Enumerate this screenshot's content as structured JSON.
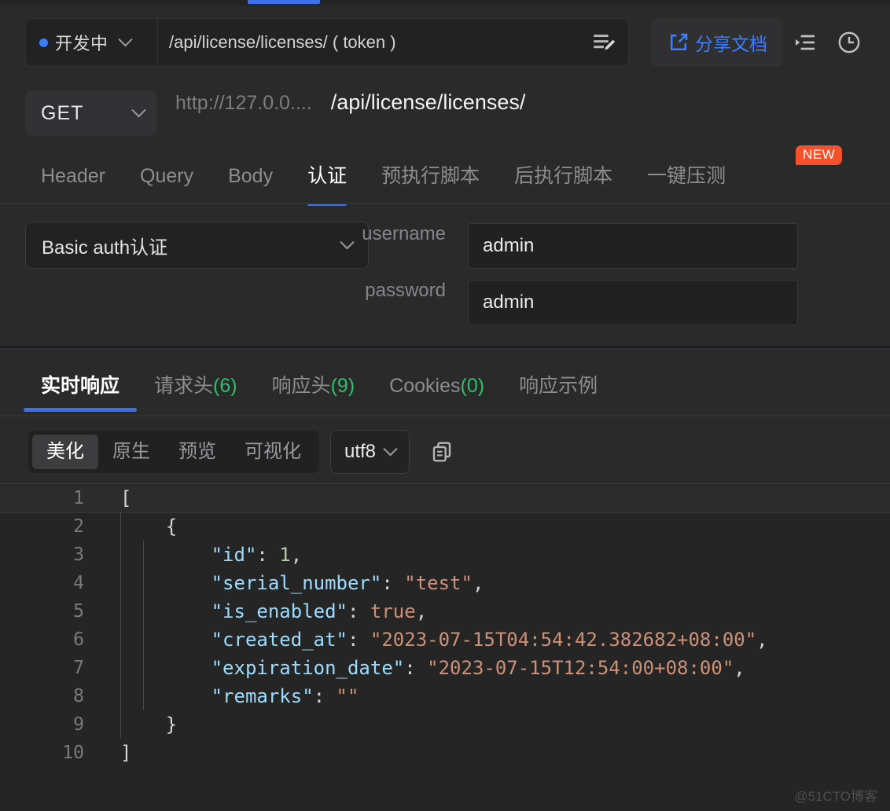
{
  "window": {
    "theme": "dark",
    "accent": "#3d6fe8",
    "badge_color": "#f6502d",
    "count_color": "#2fbf6c"
  },
  "request_header": {
    "status_label": "开发中",
    "api_name": "/api/license/licenses/ ( token )",
    "share_label": "分享文档",
    "icons": {
      "edit": "edit-icon",
      "list": "list-indent-icon",
      "history": "clock-icon",
      "status_chevron": "chevron-down-icon"
    }
  },
  "url_row": {
    "method": "GET",
    "host": "http://127.0.0....",
    "path": "/api/license/licenses/"
  },
  "request_tabs": {
    "items": [
      {
        "label": "Header",
        "active": false
      },
      {
        "label": "Query",
        "active": false
      },
      {
        "label": "Body",
        "active": false
      },
      {
        "label": "认证",
        "active": true
      },
      {
        "label": "预执行脚本",
        "active": false
      },
      {
        "label": "后执行脚本",
        "active": false
      },
      {
        "label": "一键压测",
        "active": false
      }
    ],
    "new_badge": "NEW"
  },
  "auth": {
    "type_value": "Basic auth认证",
    "fields": [
      {
        "label": "username",
        "value": "admin"
      },
      {
        "label": "password",
        "value": "admin"
      }
    ]
  },
  "response_tabs": {
    "items": [
      {
        "label": "实时响应",
        "count": "",
        "active": true
      },
      {
        "label": "请求头",
        "count": "(6)",
        "active": false
      },
      {
        "label": "响应头",
        "count": "(9)",
        "active": false
      },
      {
        "label": "Cookies",
        "count": "(0)",
        "active": false
      },
      {
        "label": "响应示例",
        "count": "",
        "active": false
      }
    ]
  },
  "format_bar": {
    "modes": [
      {
        "label": "美化",
        "active": true
      },
      {
        "label": "原生",
        "active": false
      },
      {
        "label": "预览",
        "active": false
      },
      {
        "label": "可视化",
        "active": false
      }
    ],
    "encoding": "utf8",
    "copy_icon": "copy-icon",
    "encoding_chevron": "chevron-down-icon"
  },
  "editor": {
    "lines": [
      {
        "n": "1",
        "indent": 0,
        "highlight": true,
        "tokens": [
          {
            "t": "[",
            "c": "pun"
          }
        ]
      },
      {
        "n": "2",
        "indent": 1,
        "highlight": false,
        "tokens": [
          {
            "t": "    {",
            "c": "pun"
          }
        ]
      },
      {
        "n": "3",
        "indent": 2,
        "highlight": false,
        "tokens": [
          {
            "t": "        ",
            "c": "pun"
          },
          {
            "t": "\"id\"",
            "c": "k"
          },
          {
            "t": ": ",
            "c": "pun"
          },
          {
            "t": "1",
            "c": "num"
          },
          {
            "t": ",",
            "c": "pun"
          }
        ]
      },
      {
        "n": "4",
        "indent": 2,
        "highlight": false,
        "tokens": [
          {
            "t": "        ",
            "c": "pun"
          },
          {
            "t": "\"serial_number\"",
            "c": "k"
          },
          {
            "t": ": ",
            "c": "pun"
          },
          {
            "t": "\"test\"",
            "c": "str"
          },
          {
            "t": ",",
            "c": "pun"
          }
        ]
      },
      {
        "n": "5",
        "indent": 2,
        "highlight": false,
        "tokens": [
          {
            "t": "        ",
            "c": "pun"
          },
          {
            "t": "\"is_enabled\"",
            "c": "k"
          },
          {
            "t": ": ",
            "c": "pun"
          },
          {
            "t": "true",
            "c": "bool"
          },
          {
            "t": ",",
            "c": "pun"
          }
        ]
      },
      {
        "n": "6",
        "indent": 2,
        "highlight": false,
        "tokens": [
          {
            "t": "        ",
            "c": "pun"
          },
          {
            "t": "\"created_at\"",
            "c": "k"
          },
          {
            "t": ": ",
            "c": "pun"
          },
          {
            "t": "\"2023-07-15T04:54:42.382682+08:00\"",
            "c": "str"
          },
          {
            "t": ",",
            "c": "pun"
          }
        ]
      },
      {
        "n": "7",
        "indent": 2,
        "highlight": false,
        "tokens": [
          {
            "t": "        ",
            "c": "pun"
          },
          {
            "t": "\"expiration_date\"",
            "c": "k"
          },
          {
            "t": ": ",
            "c": "pun"
          },
          {
            "t": "\"2023-07-15T12:54:00+08:00\"",
            "c": "str"
          },
          {
            "t": ",",
            "c": "pun"
          }
        ]
      },
      {
        "n": "8",
        "indent": 2,
        "highlight": false,
        "tokens": [
          {
            "t": "        ",
            "c": "pun"
          },
          {
            "t": "\"remarks\"",
            "c": "k"
          },
          {
            "t": ": ",
            "c": "pun"
          },
          {
            "t": "\"\"",
            "c": "str"
          }
        ]
      },
      {
        "n": "9",
        "indent": 1,
        "highlight": false,
        "tokens": [
          {
            "t": "    }",
            "c": "pun"
          }
        ]
      },
      {
        "n": "10",
        "indent": 0,
        "highlight": false,
        "tokens": [
          {
            "t": "]",
            "c": "pun"
          }
        ]
      }
    ]
  },
  "watermark": "@51CTO博客"
}
